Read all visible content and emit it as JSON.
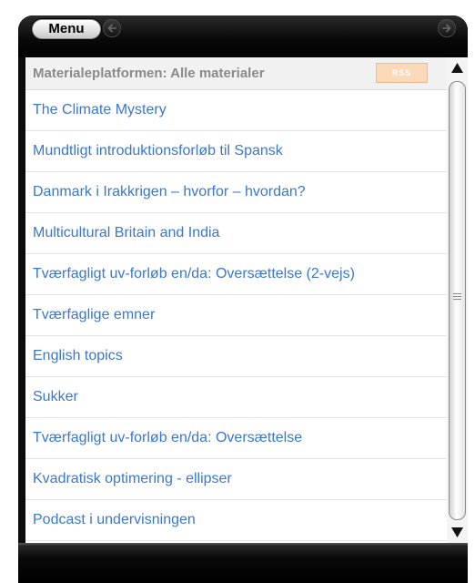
{
  "toolbar": {
    "menu_label": "Menu",
    "back_icon": "back-arrow-icon",
    "forward_icon": "forward-arrow-icon"
  },
  "header": {
    "title": "Materialeplatformen: Alle materialer",
    "rss_label": "RSS"
  },
  "list": {
    "items": [
      "The Climate Mystery",
      "Mundtligt introduktionsforløb til Spansk",
      "Danmark i Irakkrigen – hvorfor – hvordan?",
      "Multicultural Britain and India",
      "Tværfagligt uv-forløb en/da: Oversættelse (2-vejs)",
      "Tværfaglige emner",
      "English topics",
      "Sukker",
      "Tværfagligt uv-forløb en/da: Oversættelse",
      "Kvadratisk optimering - ellipser",
      "Podcast i undervisningen"
    ]
  },
  "colors": {
    "link": "#3c78c8",
    "header_text": "#8a8a8a",
    "rss_bg": "#fcd9b8",
    "chrome": "#0b0b0b"
  }
}
